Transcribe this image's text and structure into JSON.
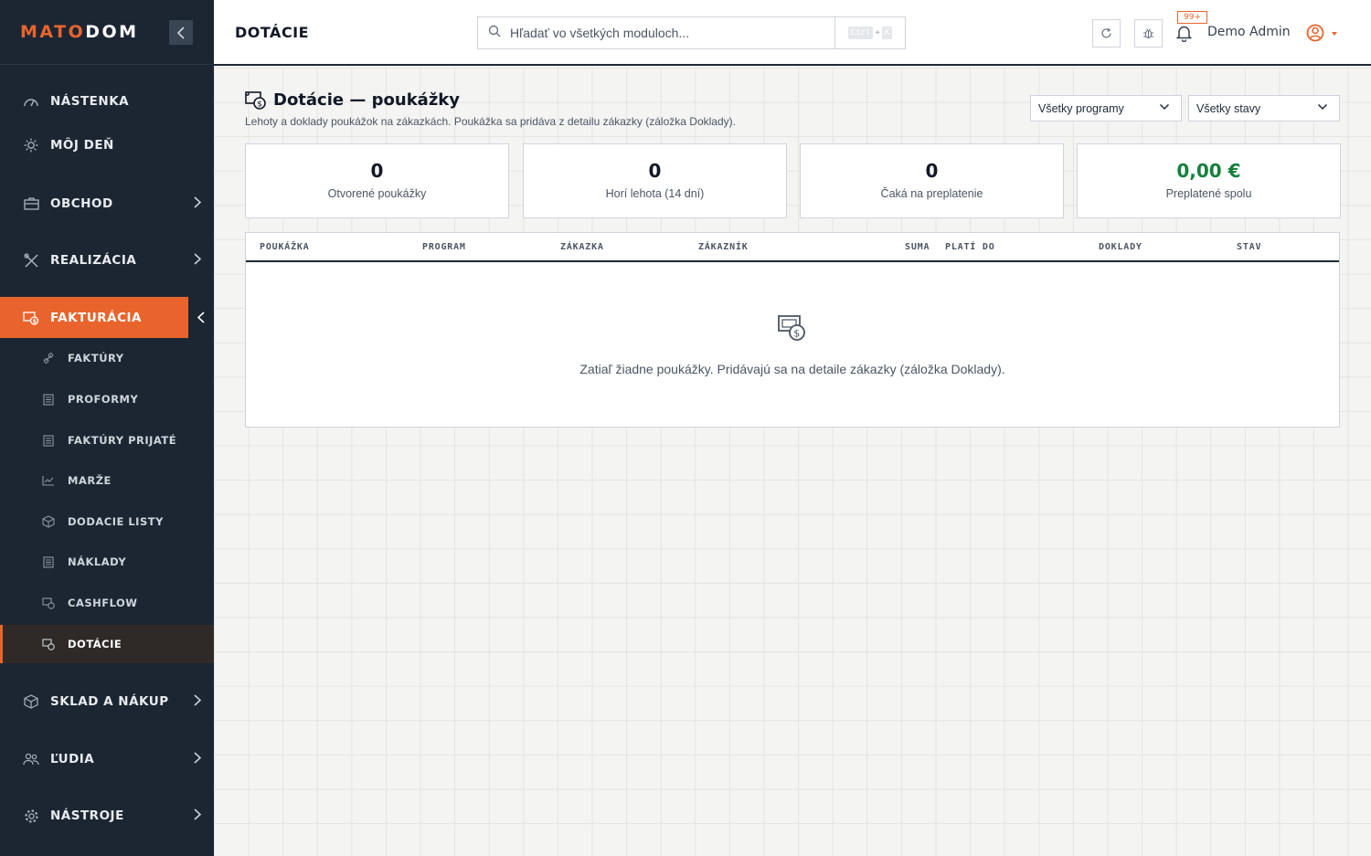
{
  "brand": {
    "part1": "MATO",
    "part2": "DOM"
  },
  "sidebar": {
    "items": [
      {
        "label": "NÁSTENKA"
      },
      {
        "label": "MÔJ DEŇ"
      },
      {
        "label": "OBCHOD"
      },
      {
        "label": "REALIZÁCIA"
      },
      {
        "label": "FAKTURÁCIA"
      },
      {
        "label": "SKLAD A NÁKUP"
      },
      {
        "label": "ĽUDIA"
      },
      {
        "label": "NÁSTROJE"
      }
    ],
    "subitems": [
      {
        "label": "FAKTÚRY"
      },
      {
        "label": "PROFORMY"
      },
      {
        "label": "FAKTÚRY PRIJATÉ"
      },
      {
        "label": "MARŽE"
      },
      {
        "label": "DODACIE LISTY"
      },
      {
        "label": "NÁKLADY"
      },
      {
        "label": "CASHFLOW"
      },
      {
        "label": "DOTÁCIE"
      }
    ]
  },
  "header": {
    "title": "DOTÁCIE",
    "search_placeholder": "Hľadať vo všetkých moduloch...",
    "kbd_ctrl": "Ctrl",
    "kbd_plus": "+",
    "kbd_k": "K",
    "badge": "99+",
    "user": "Demo Admin"
  },
  "page": {
    "title": "Dotácie — poukážky",
    "subtitle": "Lehoty a doklady poukážok na zákazkách. Poukážka sa pridáva z detailu zákazky (záložka Doklady).",
    "filter_program": "Všetky programy",
    "filter_status": "Všetky stavy"
  },
  "stats": [
    {
      "value": "0",
      "caption": "Otvorené poukážky"
    },
    {
      "value": "0",
      "caption": "Horí lehota (14 dní)"
    },
    {
      "value": "0",
      "caption": "Čaká na preplatenie"
    },
    {
      "value": "0,00 €",
      "caption": "Preplatené spolu"
    }
  ],
  "table": {
    "columns": [
      "POUKÁŽKA",
      "PROGRAM",
      "ZÁKAZKA",
      "ZÁKAZNÍK",
      "SUMA",
      "PLATÍ DO",
      "DOKLADY",
      "STAV"
    ],
    "empty": "Zatiaľ žiadne poukážky. Pridávajú sa na detaile zákazky (záložka Doklady)."
  },
  "colors": {
    "accent": "#e8642c",
    "sidebar": "#1c2633",
    "positive": "#15803d"
  }
}
